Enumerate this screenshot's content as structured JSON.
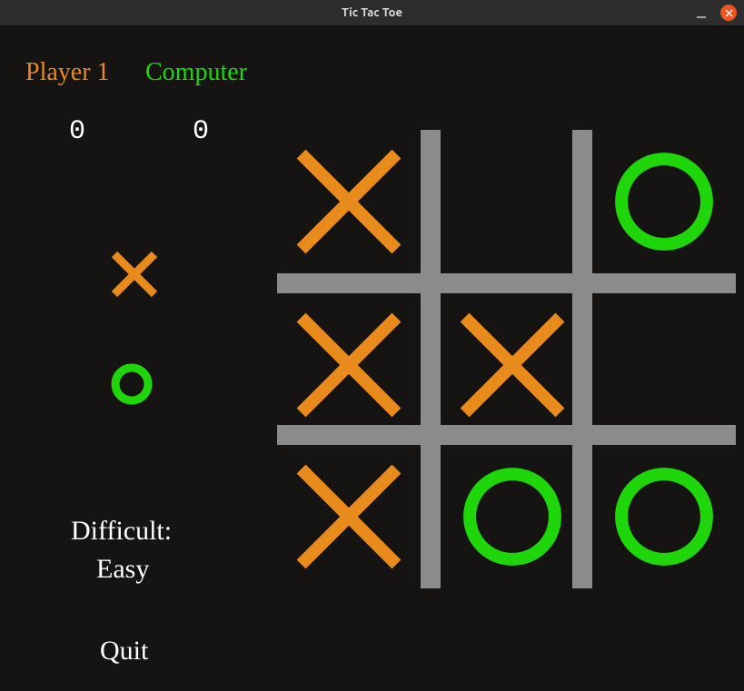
{
  "window": {
    "title": "Tic Tac Toe"
  },
  "players": {
    "p1_label": "Player 1",
    "p2_label": "Computer",
    "p1_score": "0",
    "p2_score": "0",
    "p1_mark": "X",
    "p2_mark": "O"
  },
  "difficulty": {
    "label": "Difficult:",
    "value": "Easy"
  },
  "quit_label": "Quit",
  "colors": {
    "x": "#e88b1c",
    "o": "#1ed60a",
    "grid": "#8b8b8b",
    "bg": "#161313"
  },
  "board": {
    "cells": [
      "X",
      "",
      "O",
      "X",
      "X",
      "",
      "X",
      "O",
      "O"
    ]
  }
}
